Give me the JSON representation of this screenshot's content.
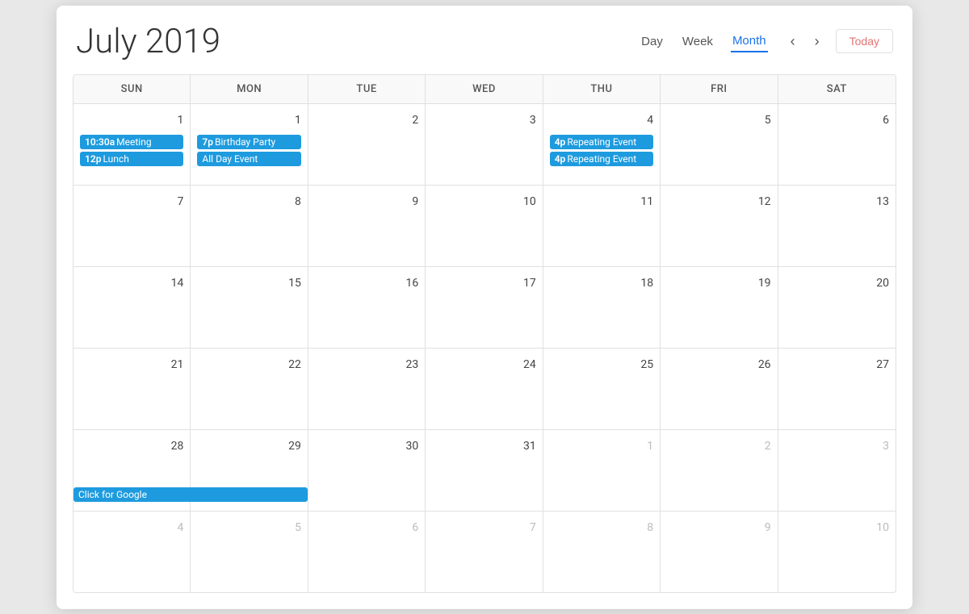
{
  "header": {
    "title": "July 2019",
    "view_day": "Day",
    "view_week": "Week",
    "view_month": "Month",
    "nav_prev": "‹",
    "nav_next": "›",
    "today_label": "Today"
  },
  "day_headers": [
    "Sun",
    "Mon",
    "Tue",
    "Wed",
    "Thu",
    "Fri",
    "Sat"
  ],
  "weeks": [
    {
      "days": [
        {
          "number": "1",
          "other_month": false,
          "today": false,
          "events": [
            {
              "id": "e1",
              "time": "10:30a",
              "title": "Meeting",
              "color": "blue"
            },
            {
              "id": "e2",
              "time": "12p",
              "title": "Lunch",
              "color": "blue"
            }
          ]
        },
        {
          "number": "1",
          "other_month": false,
          "today": false,
          "events": [
            {
              "id": "e3",
              "time": "7p",
              "title": "Birthday Party",
              "color": "blue"
            },
            {
              "id": "e4",
              "time": "",
              "title": "All Day Event",
              "color": "blue"
            }
          ]
        },
        {
          "number": "2",
          "other_month": false,
          "today": false,
          "events": []
        },
        {
          "number": "3",
          "other_month": false,
          "today": false,
          "events": []
        },
        {
          "number": "4",
          "other_month": false,
          "today": false,
          "events": [
            {
              "id": "e5",
              "time": "4p",
              "title": "Repeating Event",
              "color": "blue"
            },
            {
              "id": "e6",
              "time": "4p",
              "title": "Repeating Event",
              "color": "blue"
            }
          ]
        },
        {
          "number": "5",
          "other_month": false,
          "today": false,
          "events": []
        },
        {
          "number": "6",
          "other_month": false,
          "today": false,
          "events": []
        }
      ]
    },
    {
      "days": [
        {
          "number": "7",
          "other_month": false,
          "today": true,
          "events": []
        },
        {
          "number": "8",
          "other_month": false,
          "today": false,
          "events": []
        },
        {
          "number": "9",
          "other_month": false,
          "today": false,
          "events": []
        },
        {
          "number": "10",
          "other_month": false,
          "today": false,
          "events": []
        },
        {
          "number": "11",
          "other_month": false,
          "today": false,
          "events": []
        },
        {
          "number": "12",
          "other_month": false,
          "today": false,
          "events": []
        },
        {
          "number": "13",
          "other_month": false,
          "today": false,
          "events": []
        }
      ]
    },
    {
      "days": [
        {
          "number": "14",
          "other_month": false,
          "today": false,
          "events": []
        },
        {
          "number": "15",
          "other_month": false,
          "today": false,
          "events": []
        },
        {
          "number": "16",
          "other_month": false,
          "today": false,
          "events": []
        },
        {
          "number": "17",
          "other_month": false,
          "today": false,
          "events": []
        },
        {
          "number": "18",
          "other_month": false,
          "today": false,
          "events": []
        },
        {
          "number": "19",
          "other_month": false,
          "today": false,
          "events": []
        },
        {
          "number": "20",
          "other_month": false,
          "today": false,
          "events": []
        }
      ]
    },
    {
      "days": [
        {
          "number": "21",
          "other_month": false,
          "today": false,
          "events": []
        },
        {
          "number": "22",
          "other_month": false,
          "today": false,
          "events": []
        },
        {
          "number": "23",
          "other_month": false,
          "today": false,
          "events": []
        },
        {
          "number": "24",
          "other_month": false,
          "today": false,
          "events": []
        },
        {
          "number": "25",
          "other_month": false,
          "today": false,
          "events": []
        },
        {
          "number": "26",
          "other_month": false,
          "today": false,
          "events": []
        },
        {
          "number": "27",
          "other_month": false,
          "today": false,
          "events": []
        }
      ]
    },
    {
      "days": [
        {
          "number": "28",
          "other_month": false,
          "today": false,
          "events": [
            {
              "id": "e7",
              "time": "",
              "title": "Click for Google",
              "color": "blue",
              "span": true
            }
          ]
        },
        {
          "number": "29",
          "other_month": false,
          "today": false,
          "events": []
        },
        {
          "number": "30",
          "other_month": false,
          "today": false,
          "events": []
        },
        {
          "number": "31",
          "other_month": false,
          "today": false,
          "events": []
        },
        {
          "number": "1",
          "other_month": true,
          "today": false,
          "events": []
        },
        {
          "number": "2",
          "other_month": true,
          "today": false,
          "events": []
        },
        {
          "number": "3",
          "other_month": true,
          "today": false,
          "events": []
        }
      ]
    },
    {
      "days": [
        {
          "number": "4",
          "other_month": true,
          "today": false,
          "events": []
        },
        {
          "number": "5",
          "other_month": true,
          "today": false,
          "events": []
        },
        {
          "number": "6",
          "other_month": true,
          "today": false,
          "events": []
        },
        {
          "number": "7",
          "other_month": true,
          "today": false,
          "events": []
        },
        {
          "number": "8",
          "other_month": true,
          "today": false,
          "events": []
        },
        {
          "number": "9",
          "other_month": true,
          "today": false,
          "events": []
        },
        {
          "number": "10",
          "other_month": true,
          "today": false,
          "events": []
        }
      ]
    }
  ]
}
